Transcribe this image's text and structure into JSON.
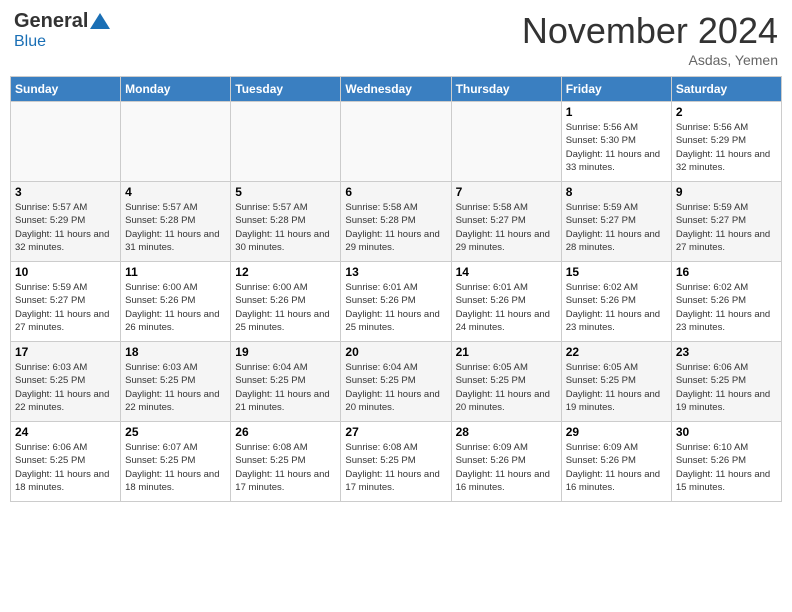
{
  "header": {
    "logo_general": "General",
    "logo_blue": "Blue",
    "month_title": "November 2024",
    "location": "Asdas, Yemen"
  },
  "weekdays": [
    "Sunday",
    "Monday",
    "Tuesday",
    "Wednesday",
    "Thursday",
    "Friday",
    "Saturday"
  ],
  "weeks": [
    [
      {
        "day": "",
        "info": ""
      },
      {
        "day": "",
        "info": ""
      },
      {
        "day": "",
        "info": ""
      },
      {
        "day": "",
        "info": ""
      },
      {
        "day": "",
        "info": ""
      },
      {
        "day": "1",
        "info": "Sunrise: 5:56 AM\nSunset: 5:30 PM\nDaylight: 11 hours and 33 minutes."
      },
      {
        "day": "2",
        "info": "Sunrise: 5:56 AM\nSunset: 5:29 PM\nDaylight: 11 hours and 32 minutes."
      }
    ],
    [
      {
        "day": "3",
        "info": "Sunrise: 5:57 AM\nSunset: 5:29 PM\nDaylight: 11 hours and 32 minutes."
      },
      {
        "day": "4",
        "info": "Sunrise: 5:57 AM\nSunset: 5:28 PM\nDaylight: 11 hours and 31 minutes."
      },
      {
        "day": "5",
        "info": "Sunrise: 5:57 AM\nSunset: 5:28 PM\nDaylight: 11 hours and 30 minutes."
      },
      {
        "day": "6",
        "info": "Sunrise: 5:58 AM\nSunset: 5:28 PM\nDaylight: 11 hours and 29 minutes."
      },
      {
        "day": "7",
        "info": "Sunrise: 5:58 AM\nSunset: 5:27 PM\nDaylight: 11 hours and 29 minutes."
      },
      {
        "day": "8",
        "info": "Sunrise: 5:59 AM\nSunset: 5:27 PM\nDaylight: 11 hours and 28 minutes."
      },
      {
        "day": "9",
        "info": "Sunrise: 5:59 AM\nSunset: 5:27 PM\nDaylight: 11 hours and 27 minutes."
      }
    ],
    [
      {
        "day": "10",
        "info": "Sunrise: 5:59 AM\nSunset: 5:27 PM\nDaylight: 11 hours and 27 minutes."
      },
      {
        "day": "11",
        "info": "Sunrise: 6:00 AM\nSunset: 5:26 PM\nDaylight: 11 hours and 26 minutes."
      },
      {
        "day": "12",
        "info": "Sunrise: 6:00 AM\nSunset: 5:26 PM\nDaylight: 11 hours and 25 minutes."
      },
      {
        "day": "13",
        "info": "Sunrise: 6:01 AM\nSunset: 5:26 PM\nDaylight: 11 hours and 25 minutes."
      },
      {
        "day": "14",
        "info": "Sunrise: 6:01 AM\nSunset: 5:26 PM\nDaylight: 11 hours and 24 minutes."
      },
      {
        "day": "15",
        "info": "Sunrise: 6:02 AM\nSunset: 5:26 PM\nDaylight: 11 hours and 23 minutes."
      },
      {
        "day": "16",
        "info": "Sunrise: 6:02 AM\nSunset: 5:26 PM\nDaylight: 11 hours and 23 minutes."
      }
    ],
    [
      {
        "day": "17",
        "info": "Sunrise: 6:03 AM\nSunset: 5:25 PM\nDaylight: 11 hours and 22 minutes."
      },
      {
        "day": "18",
        "info": "Sunrise: 6:03 AM\nSunset: 5:25 PM\nDaylight: 11 hours and 22 minutes."
      },
      {
        "day": "19",
        "info": "Sunrise: 6:04 AM\nSunset: 5:25 PM\nDaylight: 11 hours and 21 minutes."
      },
      {
        "day": "20",
        "info": "Sunrise: 6:04 AM\nSunset: 5:25 PM\nDaylight: 11 hours and 20 minutes."
      },
      {
        "day": "21",
        "info": "Sunrise: 6:05 AM\nSunset: 5:25 PM\nDaylight: 11 hours and 20 minutes."
      },
      {
        "day": "22",
        "info": "Sunrise: 6:05 AM\nSunset: 5:25 PM\nDaylight: 11 hours and 19 minutes."
      },
      {
        "day": "23",
        "info": "Sunrise: 6:06 AM\nSunset: 5:25 PM\nDaylight: 11 hours and 19 minutes."
      }
    ],
    [
      {
        "day": "24",
        "info": "Sunrise: 6:06 AM\nSunset: 5:25 PM\nDaylight: 11 hours and 18 minutes."
      },
      {
        "day": "25",
        "info": "Sunrise: 6:07 AM\nSunset: 5:25 PM\nDaylight: 11 hours and 18 minutes."
      },
      {
        "day": "26",
        "info": "Sunrise: 6:08 AM\nSunset: 5:25 PM\nDaylight: 11 hours and 17 minutes."
      },
      {
        "day": "27",
        "info": "Sunrise: 6:08 AM\nSunset: 5:25 PM\nDaylight: 11 hours and 17 minutes."
      },
      {
        "day": "28",
        "info": "Sunrise: 6:09 AM\nSunset: 5:26 PM\nDaylight: 11 hours and 16 minutes."
      },
      {
        "day": "29",
        "info": "Sunrise: 6:09 AM\nSunset: 5:26 PM\nDaylight: 11 hours and 16 minutes."
      },
      {
        "day": "30",
        "info": "Sunrise: 6:10 AM\nSunset: 5:26 PM\nDaylight: 11 hours and 15 minutes."
      }
    ]
  ]
}
